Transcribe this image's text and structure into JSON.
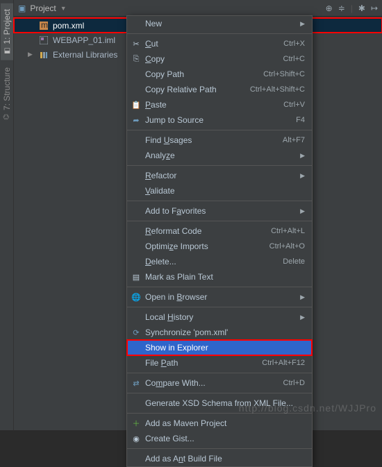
{
  "sideTabs": {
    "project": "1: Project",
    "structure": "7: Structure"
  },
  "toolbar": {
    "title": "Project"
  },
  "tree": {
    "items": [
      {
        "label": "pom.xml"
      },
      {
        "label": "WEBAPP_01.iml"
      },
      {
        "label": "External Libraries"
      }
    ]
  },
  "menu": {
    "new": "New",
    "cut": "Cut",
    "cut_sc": "Ctrl+X",
    "copy": "Copy",
    "copy_sc": "Ctrl+C",
    "copyPath": "Copy Path",
    "copyPath_sc": "Ctrl+Shift+C",
    "copyRel": "Copy Relative Path",
    "copyRel_sc": "Ctrl+Alt+Shift+C",
    "paste": "Paste",
    "paste_sc": "Ctrl+V",
    "jump": "Jump to Source",
    "jump_sc": "F4",
    "findUsages": "Find Usages",
    "findUsages_sc": "Alt+F7",
    "analyze": "Analyze",
    "refactor": "Refactor",
    "validate": "Validate",
    "addFav": "Add to Favorites",
    "reformat": "Reformat Code",
    "reformat_sc": "Ctrl+Alt+L",
    "optimize": "Optimize Imports",
    "optimize_sc": "Ctrl+Alt+O",
    "delete": "Delete...",
    "delete_sc": "Delete",
    "markPlain": "Mark as Plain Text",
    "openBrowser": "Open in Browser",
    "localHist": "Local History",
    "sync": "Synchronize 'pom.xml'",
    "showExplorer": "Show in Explorer",
    "filePath": "File Path",
    "filePath_sc": "Ctrl+Alt+F12",
    "compare": "Compare With...",
    "compare_sc": "Ctrl+D",
    "genXsd": "Generate XSD Schema from XML File...",
    "addMaven": "Add as Maven Project",
    "createGist": "Create Gist...",
    "addAnt": "Add as Ant Build File"
  },
  "watermark": "http://blog.csdn.net/WJJPro"
}
